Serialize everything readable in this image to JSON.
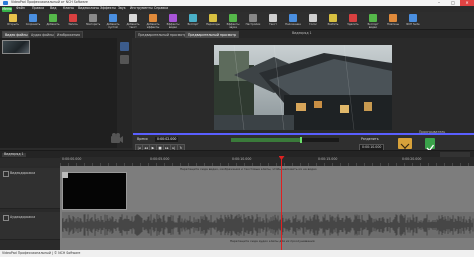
{
  "window": {
    "title": "VideoPad Профессиональный от NCH Software",
    "minimize": "–",
    "maximize": "□",
    "close": "✕"
  },
  "menu": {
    "logo": "Меню",
    "items": [
      "Файл",
      "Правка",
      "Вид",
      "Клипы",
      "Видеоклипы",
      "Эффекты",
      "Звук",
      "Инструменты",
      "Справка"
    ]
  },
  "toolbar": {
    "buttons": [
      {
        "label": "Открыть",
        "icon": "open-folder-icon",
        "color": "#e8c24a"
      },
      {
        "label": "Сохранить",
        "icon": "save-icon",
        "color": "#4a8fe0"
      },
      {
        "label": "Добавить",
        "icon": "add-file-icon",
        "color": "#55b84a"
      },
      {
        "label": "Запись",
        "icon": "record-icon",
        "color": "#d94040"
      },
      {
        "label": "Повторить",
        "icon": "redo-icon",
        "color": "#8a8a8a"
      },
      {
        "label": "Добавить пустой",
        "icon": "blank-clip-icon",
        "color": "#4a8fe0"
      },
      {
        "label": "Добавить текст",
        "icon": "text-icon",
        "color": "#d8d8d8"
      },
      {
        "label": "Добавить эффекты",
        "icon": "effects-icon",
        "color": "#e08a3a"
      },
      {
        "label": "Эффекты видео",
        "icon": "fx-icon",
        "color": "#a855d8"
      },
      {
        "label": "Экспорт",
        "icon": "export-icon",
        "color": "#4ab0c8"
      },
      {
        "label": "Переходы",
        "icon": "transition-icon",
        "color": "#d8c040"
      },
      {
        "label": "Эффекты звука",
        "icon": "audio-fx-icon",
        "color": "#55b84a"
      },
      {
        "label": "Настройки",
        "icon": "settings-icon",
        "color": "#888888"
      },
      {
        "label": "Текст",
        "icon": "text-block-icon",
        "color": "#cfcfcf"
      },
      {
        "label": "Наложение",
        "icon": "overlay-icon",
        "color": "#4a8fe0"
      },
      {
        "label": "Голос",
        "icon": "mic-icon",
        "color": "#cfcfcf"
      },
      {
        "label": "Разбить",
        "icon": "split-icon",
        "color": "#d8c040"
      },
      {
        "label": "Удалить",
        "icon": "delete-icon",
        "color": "#d94040"
      },
      {
        "label": "Экспорт видео",
        "icon": "export-video-icon",
        "color": "#55b84a"
      },
      {
        "label": "Плагины",
        "icon": "plugins-icon",
        "color": "#e08a3a"
      },
      {
        "label": "NCH Suite",
        "icon": "suite-icon",
        "color": "#4a8fe0"
      }
    ]
  },
  "tabs": {
    "left": [
      "Видео файлы",
      "Аудио файлы",
      "Изображения"
    ],
    "right": [
      "Предварительный просмотр клипа",
      "Предварительный просмотр"
    ]
  },
  "preview": {
    "sequence_label": "Видеоряд 1",
    "timecode": "0:00:02.000",
    "timecode_end": "0:00:10.000",
    "zoom_label": "Разделить",
    "monitor_label": "Проигрыватель"
  },
  "timeline": {
    "sequence_tab": "Видеоряд 1",
    "ruler_marks": [
      "0:00:00.000",
      "0:00:05.000",
      "0:00:10.000",
      "0:00:15.000",
      "0:00:20.000"
    ],
    "video_track": "Видеодорожка",
    "audio_track": "Аудиодорожка",
    "video_hint": "Перетащите сюда видео, изображения и текстовые клипы, чтобы наложить их на видео",
    "audio_hint": "Перетащите сюда аудио клипы для их прослушивания"
  },
  "status": {
    "text": "VideoPad Профессиональный | © NCH Software"
  },
  "colors": {
    "playhead": "#e02020",
    "accent": "#5a5fff",
    "waveform": "#3c3c3c"
  }
}
